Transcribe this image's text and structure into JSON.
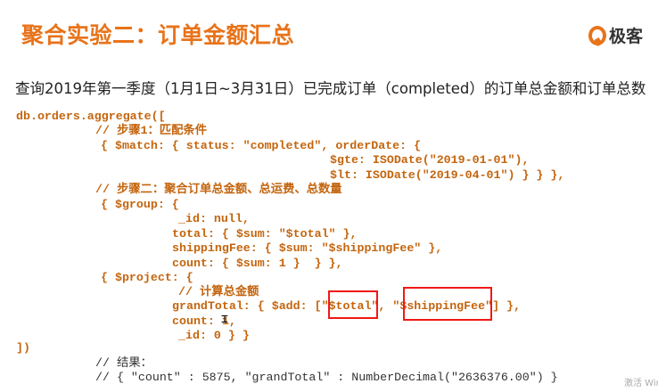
{
  "slide": {
    "title": "聚合实验二：订单金额汇总",
    "logo_text": "极客",
    "subtitle": "查询2019年第一季度（1月1日~3月31日）已完成订单（completed）的订单总金额和订单总数",
    "code_lines": [
      "db.orders.aggregate([",
      "// 步骤1：匹配条件",
      "{ $match: { status: \"completed\", orderDate: {",
      "$gte: ISODate(\"2019-01-01\"),",
      "$lt: ISODate(\"2019-04-01\") } } },",
      "// 步骤二：聚合订单总金额、总运费、总数量",
      "{ $group: {",
      "_id: null,",
      "total: { $sum: \"$total\" },",
      "shippingFee: { $sum: \"$shippingFee\" },",
      "count: { $sum: 1 }  } },",
      "{ $project: {",
      "// 计算总金额",
      "grandTotal: { $add: [\"$total\", \"$shippingFee\"] },",
      "count: 1,",
      "_id: 0 } }",
      "])",
      "// 结果：",
      "// { \"count\" : 5875, \"grandTotal\" : NumberDecimal(\"2636376.00\") }"
    ],
    "watermark": "激活 Wind"
  },
  "colors": {
    "title": "#e8731a",
    "code": "#c4650e",
    "highlight": "#f01818"
  }
}
